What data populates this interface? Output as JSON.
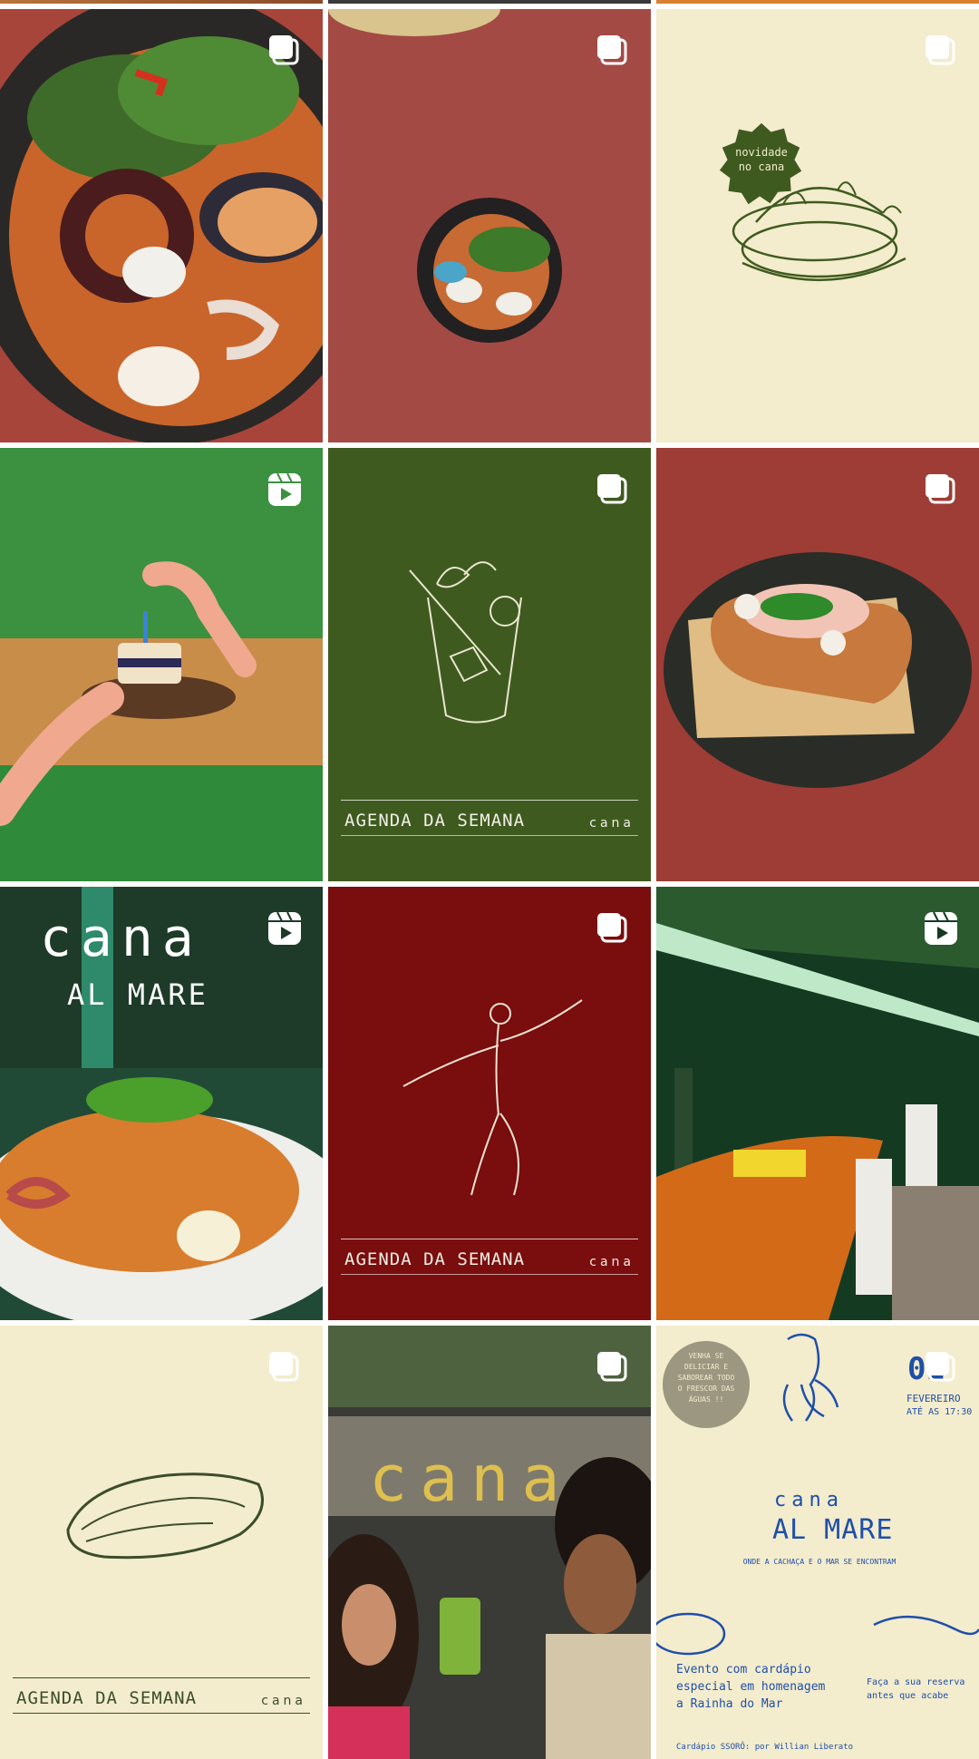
{
  "colors": {
    "cream": "#f3eccd",
    "green": "#3f5a1f",
    "wine": "#7a0d0d",
    "terracotta": "#a84a3e",
    "lineGreen": "#3b4d2a",
    "navy": "#1f4fa8"
  },
  "tiles": [
    {
      "id": "t1",
      "badge": "carousel-icon"
    },
    {
      "id": "t2",
      "badge": "carousel-icon"
    },
    {
      "id": "t3",
      "badge": "carousel-icon",
      "stamp_line1": "novidade",
      "stamp_line2": "no cana"
    },
    {
      "id": "t4",
      "badge": "reels-icon"
    },
    {
      "id": "t5",
      "badge": "carousel-icon",
      "agenda": "AGENDA DA SEMANA",
      "brand": "cana"
    },
    {
      "id": "t6",
      "badge": "carousel-icon"
    },
    {
      "id": "t7",
      "badge": "reels-icon",
      "line1": "cana",
      "line2": "AL MARE"
    },
    {
      "id": "t8",
      "badge": "carousel-icon",
      "agenda": "AGENDA DA SEMANA",
      "brand": "cana"
    },
    {
      "id": "t9",
      "badge": "reels-icon"
    },
    {
      "id": "t10",
      "badge": "carousel-icon",
      "agenda": "AGENDA DA SEMANA",
      "brand": "cana"
    },
    {
      "id": "t11",
      "badge": "carousel-icon",
      "sign": "cana"
    },
    {
      "id": "t12",
      "badge": "carousel-icon",
      "bubble": [
        "VENHA SE",
        "DELICIAR E",
        "SABOREAR TODO",
        "O FRESCOR DAS",
        "ÁGUAS !!"
      ],
      "date": "01",
      "month": "FEVEREIRO",
      "time": "ATÉ AS 17:30",
      "brand": "cana",
      "title": "AL MARE",
      "subtitle": "ONDE A CACHAÇA E O MAR SE ENCONTRAM",
      "event": [
        "Evento com cardápio",
        "especial em homenagem",
        "a Rainha do Mar"
      ],
      "cta": [
        "Faça a sua reserva",
        "antes que acabe"
      ],
      "credit": "Cardápio SSORÔ: por Willian Liberato"
    }
  ]
}
